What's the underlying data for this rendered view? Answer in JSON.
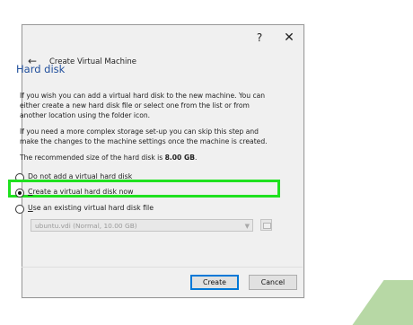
{
  "window": {
    "help_glyph": "?",
    "close_glyph": "✕"
  },
  "header": {
    "back_glyph": "←",
    "title": "Create Virtual Machine"
  },
  "section": {
    "title": "Hard disk"
  },
  "text": {
    "para1": "If you wish you can add a virtual hard disk to the new machine. You can either create a new hard disk file or select one from the list or from another location using the folder icon.",
    "para2": "If you need a more complex storage set-up you can skip this step and make the changes to the machine settings once the machine is created.",
    "para3_prefix": "The recommended size of the hard disk is ",
    "para3_value": "8.00 GB",
    "para3_suffix": "."
  },
  "options": [
    {
      "mnemonic": "D",
      "rest": "o not add a virtual hard disk",
      "checked": false
    },
    {
      "mnemonic": "C",
      "rest": "reate a virtual hard disk now",
      "checked": true
    },
    {
      "mnemonic": "U",
      "rest": "se an existing virtual hard disk file",
      "checked": false
    }
  ],
  "existing_disk": {
    "selected": "ubuntu.vdi (Normal, 10.00 GB)",
    "arrow_glyph": "▼",
    "browse_icon": "folder-icon"
  },
  "buttons": {
    "create": "Create",
    "cancel": "Cancel"
  },
  "colors": {
    "highlight": "#1fe11f",
    "section_title": "#1f4e9c",
    "default_button_border": "#0078d7"
  }
}
